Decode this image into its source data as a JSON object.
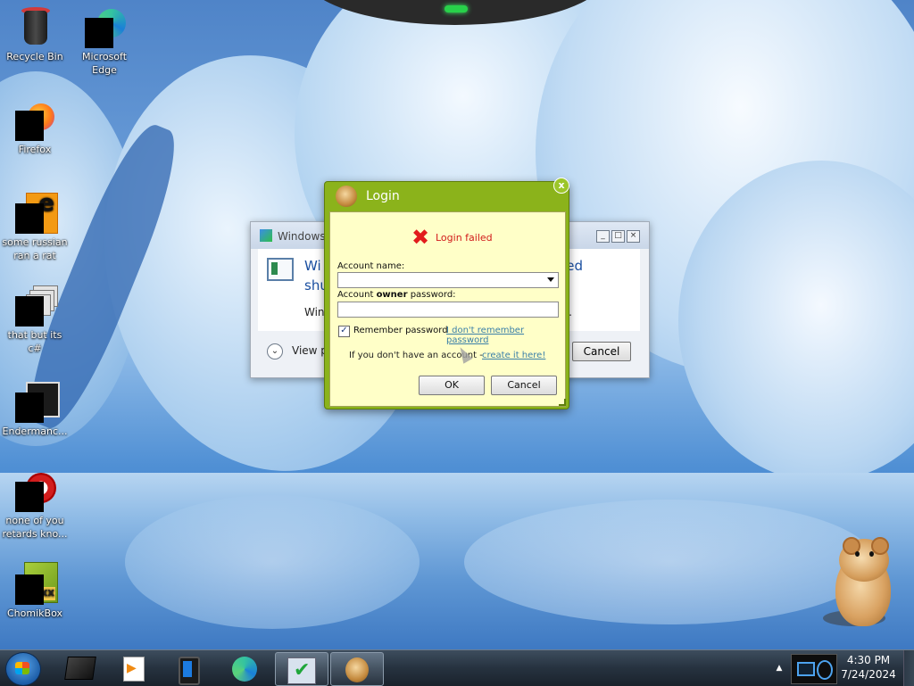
{
  "desktop": {
    "icons": [
      {
        "label": "Recycle Bin",
        "icon": "recycle-bin-icon"
      },
      {
        "label": "Microsoft Edge",
        "icon": "edge-icon"
      },
      {
        "label": "Firefox",
        "icon": "firefox-icon"
      },
      {
        "label": "some russian ran a rat",
        "icon": "orange-file-icon"
      },
      {
        "label": "that but its c#",
        "icon": "stacked-windows-icon"
      },
      {
        "label": "Endermanc...",
        "icon": "terminal-icon"
      },
      {
        "label": "none of you retards kno...",
        "icon": "red-circle-icon"
      },
      {
        "label": "ChomikBox",
        "icon": "chomikbox-icon"
      }
    ]
  },
  "windows_dialog": {
    "title": "Windows",
    "heading_start": "Wi",
    "heading_line2": "shu",
    "heading_end": "ed",
    "body_start": "Win",
    "body_end": ".",
    "view_label": "View p",
    "cancel_label": "Cancel"
  },
  "login_dialog": {
    "title": "Login",
    "error_text": "Login failed",
    "account_name_label": "Account name:",
    "account_name_value": "",
    "password_label_prefix": "Account ",
    "password_label_bold": "owner",
    "password_label_suffix": " password:",
    "password_value": "",
    "remember_label": "Remember password",
    "remember_checked": true,
    "forgot_link": "I don't remember password",
    "no_account_text": "If you don't have an account - ",
    "create_link": "create it here!",
    "ok_label": "OK",
    "cancel_label": "Cancel",
    "close_glyph": "x"
  },
  "taskbar": {
    "time": "4:30 PM",
    "date": "7/24/2024",
    "pinned": [
      {
        "name": "dark-app-icon"
      },
      {
        "name": "media-player-icon"
      },
      {
        "name": "tablet-icon"
      },
      {
        "name": "edge-icon"
      },
      {
        "name": "checkmark-app-icon",
        "active": true
      },
      {
        "name": "chomikbox-hamster-icon",
        "active": true
      }
    ]
  },
  "colors": {
    "login_frame": "#8bb31b",
    "login_body": "#ffffc8",
    "error_red": "#d11a1a",
    "link_blue": "#3a7fa8",
    "taskbar": "#26323f"
  }
}
